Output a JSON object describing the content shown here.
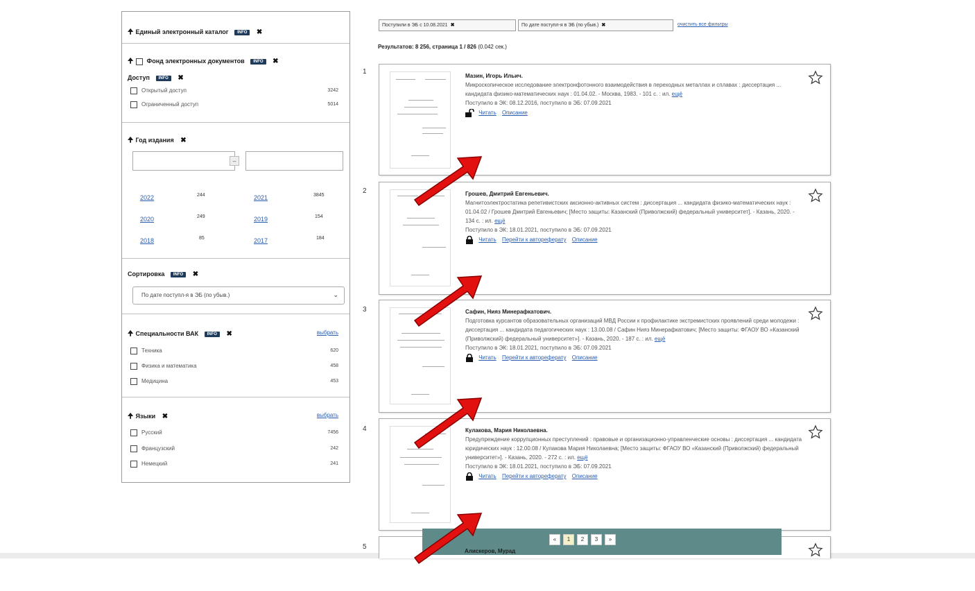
{
  "sidebar": {
    "catalog": {
      "title": "Единый электронный каталог",
      "badge": "INFO"
    },
    "fund": {
      "title": "Фонд электронных документов",
      "badge": "INFO"
    },
    "access": {
      "title": "Доступ",
      "badge": "INFO",
      "items": [
        {
          "label": "Открытый доступ",
          "count": "3242"
        },
        {
          "label": "Ограниченный доступ",
          "count": "5014"
        }
      ]
    },
    "year": {
      "title": "Год издания",
      "from_value": "",
      "to_value": "",
      "dash": "–",
      "items": [
        {
          "year": "2022",
          "count": "244"
        },
        {
          "year": "2021",
          "count": "3845"
        },
        {
          "year": "2020",
          "count": "249"
        },
        {
          "year": "2019",
          "count": "154"
        },
        {
          "year": "2018",
          "count": "85"
        },
        {
          "year": "2017",
          "count": "184"
        }
      ]
    },
    "sort": {
      "title": "Сортировка",
      "badge": "INFO",
      "selected": "По дате поступл-я в ЭБ (по убыв.)"
    },
    "vak": {
      "title": "Специальности ВАК",
      "badge": "INFO",
      "choose": "выбрать",
      "items": [
        {
          "label": "Техника",
          "count": "620"
        },
        {
          "label": "Физика и математика",
          "count": "458"
        },
        {
          "label": "Медицина",
          "count": "453"
        }
      ]
    },
    "lang": {
      "title": "Языки",
      "choose": "выбрать",
      "items": [
        {
          "label": "Русский",
          "count": "7456"
        },
        {
          "label": "Французский",
          "count": "242"
        },
        {
          "label": "Немецкий",
          "count": "241"
        }
      ]
    }
  },
  "filters": {
    "chip1": "Поступили в ЭБ с 10.08.2021",
    "chip2": "По дате поступл-я в ЭБ (по убыв.)",
    "clear": "очистить все фильтры",
    "results_label": "Результатов: 8 256, страница 1 / 826",
    "results_time": "(0.042 сек.)"
  },
  "results": [
    {
      "num": "1",
      "author": "Мазин, Игорь Ильич.",
      "desc": "Микроскопическое исследование электронфотонного взаимодействия в переходных металлах и сплавах : диссертация ... кандидата физико-математических наук : 01.04.02. - Москва, 1983. - 101 с. : ил.",
      "more": "ещё",
      "status": "Поступило в ЭК: 08.12.2016, поступило в ЭБ: 07.09.2021",
      "read": "Читать",
      "auto": "",
      "descr": "Описание"
    },
    {
      "num": "2",
      "author": "Грошев, Дмитрий Евгеньевич.",
      "desc": "Магнитоэлектростатика репетивистских аксионно-активных систем : диссертация ... кандидата физико-математических наук : 01.04.02 / Грошев Дмитрий Евгеньевич; [Место защиты: Казанский (Приволжский) федеральный университет]. - Казань, 2020. - 134 с. : ил.",
      "more": "ещё",
      "status": "Поступило в ЭК: 18.01.2021, поступило в ЭБ: 07.09.2021",
      "read": "Читать",
      "auto": "Перейти к автореферату",
      "descr": "Описание"
    },
    {
      "num": "3",
      "author": "Сафин, Нияз Минерафкатович.",
      "desc": "Подготовка курсантов образовательных организаций МВД России к профилактике экстремистских проявлений среди молодежи : диссертация ... кандидата педагогических наук : 13.00.08 / Сафин Нияз Минерафкатович; [Место защиты: ФГАОУ ВО «Казанский (Приволжский) федеральный университет»]. - Казань, 2020. - 187 с. : ил.",
      "more": "ещё",
      "status": "Поступило в ЭК: 18.01.2021, поступило в ЭБ: 07.09.2021",
      "read": "Читать",
      "auto": "Перейти к автореферату",
      "descr": "Описание"
    },
    {
      "num": "4",
      "author": "Кулакова, Мария Николаевна.",
      "desc": "Предупреждение коррупционных преступлений : правовые и организационно-управленческие основы : диссертация ... кандидата юридических наук : 12.00.08 / Кулакова Мария Николаевна; [Место защиты: ФГАОУ ВО «Казанский (Приволжский) федеральный университет»]. - Казань, 2020. - 272 с. : ил.",
      "more": "ещё",
      "status": "Поступило в ЭК: 18.01.2021, поступило в ЭБ: 07.09.2021",
      "read": "Читать",
      "auto": "Перейти к автореферату",
      "descr": "Описание"
    }
  ],
  "result5": {
    "num": "5",
    "author": "Алискеров, Мурад"
  },
  "pager": {
    "prev": "«",
    "p1": "1",
    "p2": "2",
    "p3": "3",
    "next": "»"
  },
  "icons": {
    "pin": "pin-icon",
    "close": "close-icon",
    "lock": "lock-icon",
    "unlock": "unlock-icon",
    "star": "star-icon",
    "arrow": "red-arrow"
  },
  "colors": {
    "badge": "#1f3b5c",
    "link": "#2a5db0",
    "arrow": "#e31010",
    "pager_bar": "#5e8a8a"
  }
}
